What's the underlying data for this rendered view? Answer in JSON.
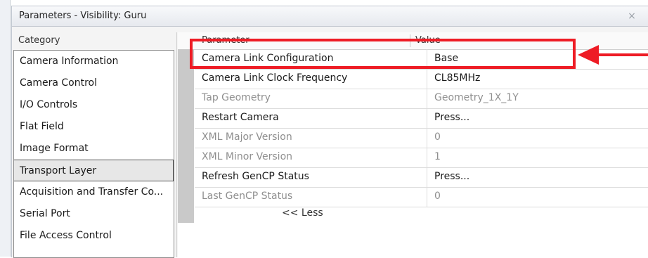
{
  "window": {
    "title": "Parameters - Visibility: Guru",
    "close_glyph": "×"
  },
  "category": {
    "header": "Category",
    "items": [
      {
        "label": "Camera Information"
      },
      {
        "label": "Camera Control"
      },
      {
        "label": "I/O Controls"
      },
      {
        "label": "Flat Field"
      },
      {
        "label": "Image Format"
      },
      {
        "label": "Transport Layer",
        "selected": true
      },
      {
        "label": "Acquisition and Transfer Co..."
      },
      {
        "label": "Serial Port"
      },
      {
        "label": "File Access Control"
      }
    ]
  },
  "parameters": {
    "header_parameter": "Parameter",
    "header_value": "Value",
    "rows": [
      {
        "name": "Camera Link Configuration",
        "value": "Base",
        "enabled": true
      },
      {
        "name": "Camera Link Clock Frequency",
        "value": "CL85MHz",
        "enabled": true
      },
      {
        "name": "Tap Geometry",
        "value": "Geometry_1X_1Y",
        "enabled": false
      },
      {
        "name": "Restart Camera",
        "value": "Press...",
        "enabled": true
      },
      {
        "name": "XML Major Version",
        "value": "0",
        "enabled": false
      },
      {
        "name": "XML Minor Version",
        "value": "1",
        "enabled": false
      },
      {
        "name": "Refresh GenCP Status",
        "value": "Press...",
        "enabled": true
      },
      {
        "name": "Last GenCP Status",
        "value": "0",
        "enabled": false
      }
    ],
    "less_label": "<< Less"
  },
  "annotation": {
    "color": "#ee1c25"
  }
}
